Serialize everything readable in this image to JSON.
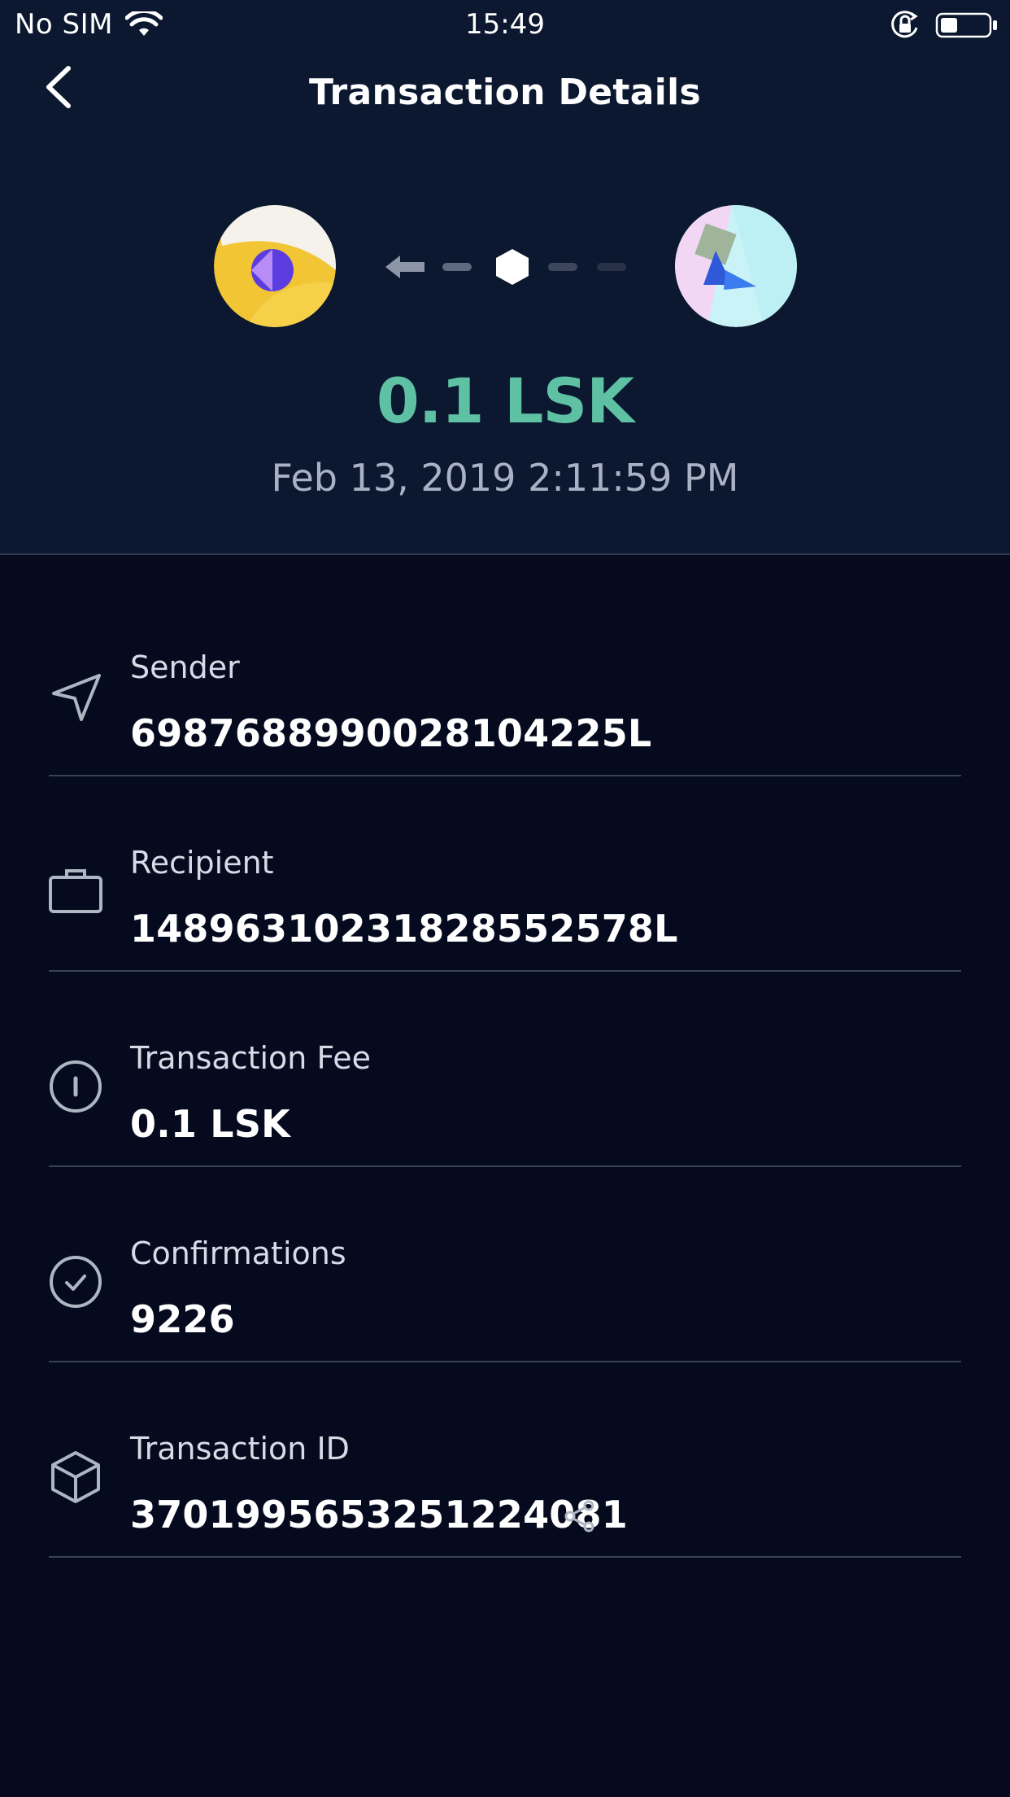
{
  "status_bar": {
    "carrier": "No SIM",
    "time": "15:49"
  },
  "header": {
    "title": "Transaction Details",
    "back_icon": "chevron-left-icon"
  },
  "transaction": {
    "amount": "0.1 LSK",
    "date": "Feb 13, 2019 2:11:59 PM",
    "direction_icon": "arrow-left-icon"
  },
  "details": {
    "sender": {
      "label": "Sender",
      "value": "6987688990028104225L",
      "icon": "send-icon"
    },
    "recipient": {
      "label": "Recipient",
      "value": "14896310231828552578L",
      "icon": "briefcase-icon"
    },
    "fee": {
      "label": "Transaction Fee",
      "value": "0.1 LSK",
      "icon": "coin-icon"
    },
    "confirmations": {
      "label": "Confirmations",
      "value": "9226",
      "icon": "check-circle-icon"
    },
    "transaction_id": {
      "label": "Transaction ID",
      "value": "3701995653251224081",
      "icon": "cube-icon",
      "share_icon": "share-icon"
    }
  },
  "colors": {
    "header_bg": "#0b1830",
    "body_bg": "#050a1f",
    "amount": "#5ec1a4",
    "date": "#a9b2c4",
    "divider": "#3a4254"
  }
}
